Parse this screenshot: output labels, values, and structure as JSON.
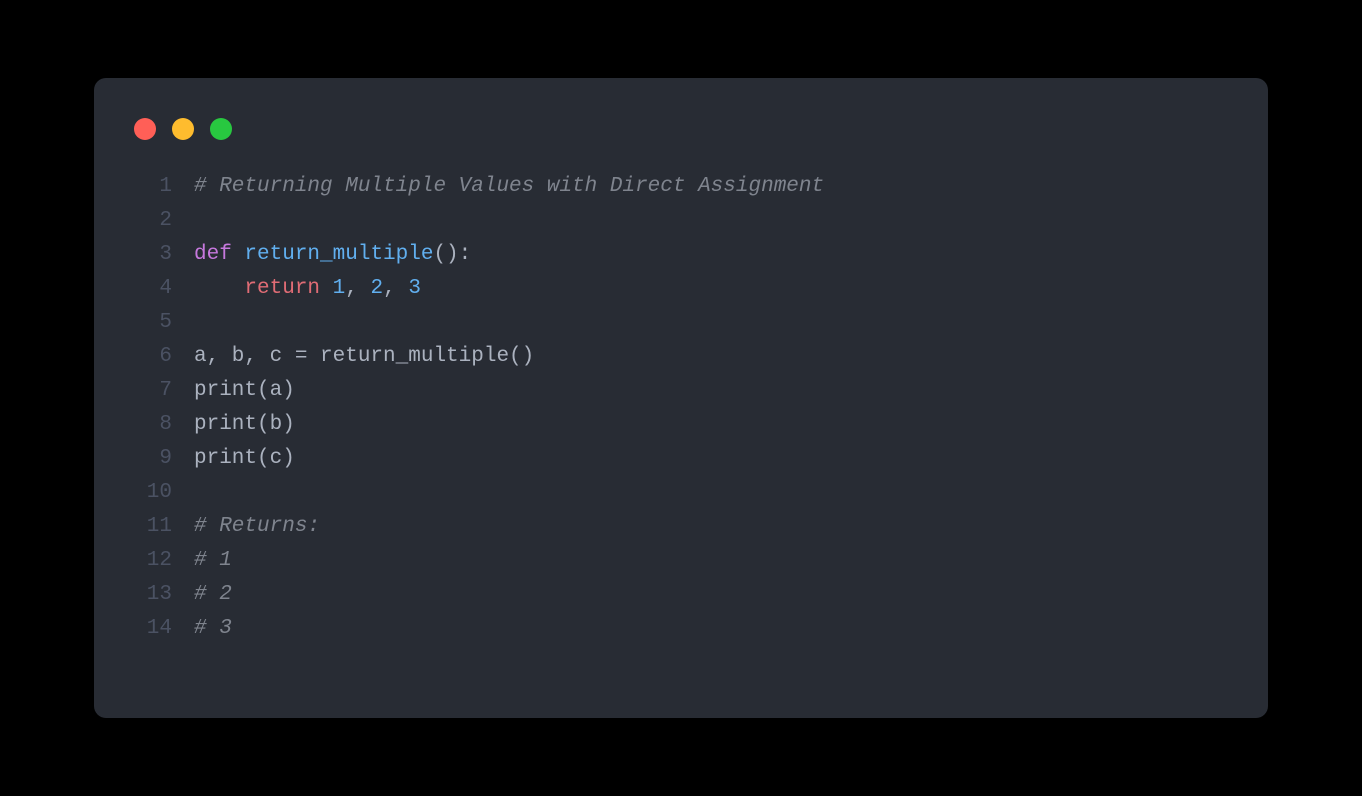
{
  "colors": {
    "background": "#000000",
    "card": "#282c34",
    "lineno": "#4b5263",
    "plain": "#abb2bf",
    "comment": "#7f848e",
    "keyword": "#c678dd",
    "def_name": "#61afef",
    "return_kw": "#e06c75",
    "number": "#61afef",
    "traffic_red": "#ff5f57",
    "traffic_yellow": "#febc2e",
    "traffic_green": "#28c840"
  },
  "lines": [
    {
      "n": "1",
      "tokens": [
        [
          "comment",
          "# Returning Multiple Values with Direct Assignment"
        ]
      ]
    },
    {
      "n": "2",
      "tokens": []
    },
    {
      "n": "3",
      "tokens": [
        [
          "keyword",
          "def"
        ],
        [
          "plain",
          " "
        ],
        [
          "def",
          "return_multiple"
        ],
        [
          "plain",
          "():"
        ]
      ]
    },
    {
      "n": "4",
      "tokens": [
        [
          "plain",
          "    "
        ],
        [
          "return",
          "return"
        ],
        [
          "plain",
          " "
        ],
        [
          "number",
          "1"
        ],
        [
          "plain",
          ", "
        ],
        [
          "number",
          "2"
        ],
        [
          "plain",
          ", "
        ],
        [
          "number",
          "3"
        ]
      ]
    },
    {
      "n": "5",
      "tokens": []
    },
    {
      "n": "6",
      "tokens": [
        [
          "plain",
          "a, b, c = return_multiple()"
        ]
      ]
    },
    {
      "n": "7",
      "tokens": [
        [
          "func",
          "print"
        ],
        [
          "plain",
          "(a)"
        ]
      ]
    },
    {
      "n": "8",
      "tokens": [
        [
          "func",
          "print"
        ],
        [
          "plain",
          "(b)"
        ]
      ]
    },
    {
      "n": "9",
      "tokens": [
        [
          "func",
          "print"
        ],
        [
          "plain",
          "(c)"
        ]
      ]
    },
    {
      "n": "10",
      "tokens": []
    },
    {
      "n": "11",
      "tokens": [
        [
          "comment",
          "# Returns:"
        ]
      ]
    },
    {
      "n": "12",
      "tokens": [
        [
          "comment",
          "# 1"
        ]
      ]
    },
    {
      "n": "13",
      "tokens": [
        [
          "comment",
          "# 2"
        ]
      ]
    },
    {
      "n": "14",
      "tokens": [
        [
          "comment",
          "# 3"
        ]
      ]
    }
  ]
}
